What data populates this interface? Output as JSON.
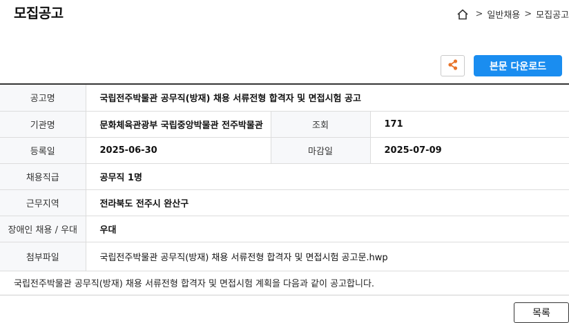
{
  "page": {
    "title": "모집공고"
  },
  "breadcrumb": {
    "separator": ">",
    "items": [
      "일반채용",
      "모집공고"
    ]
  },
  "actions": {
    "share_icon": "share-icon",
    "download_label": "본문 다운로드"
  },
  "colors": {
    "accent": "#1a8df0",
    "share_icon": "#e8742a"
  },
  "info": {
    "title_label": "공고명",
    "title_value": "국립전주박물관 공무직(방재) 채용 서류전형 합격자 및 면접시험 공고",
    "org_label": "기관명",
    "org_value": "문화체육관광부 국립중앙박물관 전주박물관",
    "views_label": "조회",
    "views_value": "171",
    "reg_label": "등록일",
    "reg_value": "2025-06-30",
    "deadline_label": "마감일",
    "deadline_value": "2025-07-09",
    "grade_label": "채용직급",
    "grade_value": "공무직 1명",
    "region_label": "근무지역",
    "region_value": "전라북도 전주시 완산구",
    "disabled_label": "장애인 채용 / 우대",
    "disabled_value": "우대",
    "attach_label": "첨부파일",
    "attach_value": "국립전주박물관 공무직(방재) 채용 서류전형 합격자 및 면접시험 공고문.hwp"
  },
  "body": {
    "text": "국립전주박물관 공무직(방재) 채용 서류전형 합격자 및 면접시험 계획을 다음과 같이 공고합니다."
  },
  "footer": {
    "list_label": "목록"
  }
}
